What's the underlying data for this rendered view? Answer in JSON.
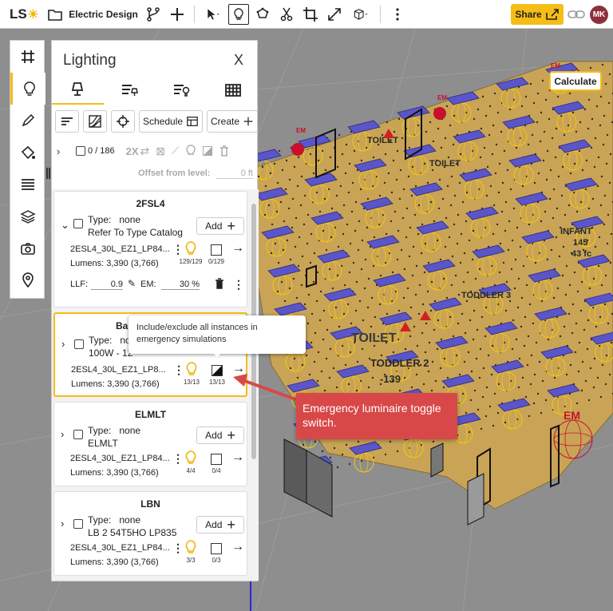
{
  "app": {
    "logo": "LS",
    "project_title": "Electric Design"
  },
  "header": {
    "share_label": "Share",
    "avatar_initials": "MK",
    "calculate_label": "Calculate"
  },
  "panel": {
    "title": "Lighting",
    "close": "X",
    "tools": {
      "schedule_label": "Schedule",
      "create_label": "Create"
    },
    "selection": {
      "count": "0 / 186",
      "multiplier": "2X"
    },
    "offset": {
      "label": "Offset from level:",
      "value": "0",
      "unit": "ft"
    },
    "cards": [
      {
        "title": "2FSL4",
        "type_label": "Type:",
        "type_value": "none",
        "description": "Refer To Type Catalog",
        "add_label": "Add",
        "luminaire": "2ESL4_30L_EZ1_LP84...",
        "lumens": "Lumens: 3,390 (3,766)",
        "instances": "129/129",
        "emergency": "0/129",
        "llf_label": "LLF:",
        "llf_value": "0.9",
        "em_label": "EM:",
        "em_value": "30",
        "em_unit": "%"
      },
      {
        "title": "Bas",
        "type_label": "Type:",
        "type_value": "nor",
        "description": "100W - 12",
        "luminaire": "2ESL4_30L_EZ1_LP8...",
        "lumens": "Lumens: 3,390 (3,766)",
        "instances": "13/13",
        "emergency": "13/13"
      },
      {
        "title": "ELMLT",
        "type_label": "Type:",
        "type_value": "none",
        "description": "ELMLT",
        "add_label": "Add",
        "luminaire": "2ESL4_30L_EZ1_LP84...",
        "lumens": "Lumens: 3,390 (3,766)",
        "instances": "4/4",
        "emergency": "0/4"
      },
      {
        "title": "LBN",
        "type_label": "Type:",
        "type_value": "none",
        "description": "LB 2 54T5HO LP835",
        "add_label": "Add",
        "luminaire": "2ESL4_30L_EZ1_LP84...",
        "lumens": "Lumens: 3,390 (3,766)",
        "instances": "3/3",
        "emergency": "0/3"
      }
    ]
  },
  "tooltip": {
    "text": "Include/exclude all instances in emergency simulations"
  },
  "callout": {
    "text": "Emergency luminaire toggle switch."
  },
  "scene_labels": {
    "toilet1": "TOILET",
    "toilet2": "TOILET",
    "toilet3": "TOILET",
    "toddler2": "TODDLER 2",
    "toddler2b": "TODDLER 3",
    "infant": "INFANT",
    "num_139": "-139",
    "num_145": "145",
    "num_43fc": "43 fc",
    "em1": "EM",
    "em2": "EM",
    "em3": "EM",
    "em4": "EM"
  },
  "colors": {
    "accent": "#f6bd16",
    "callout": "#d84848",
    "floor": "#c9a456",
    "fixture": "#5a55c8",
    "sphere": "#f3c713",
    "em_red": "#c8102e"
  }
}
